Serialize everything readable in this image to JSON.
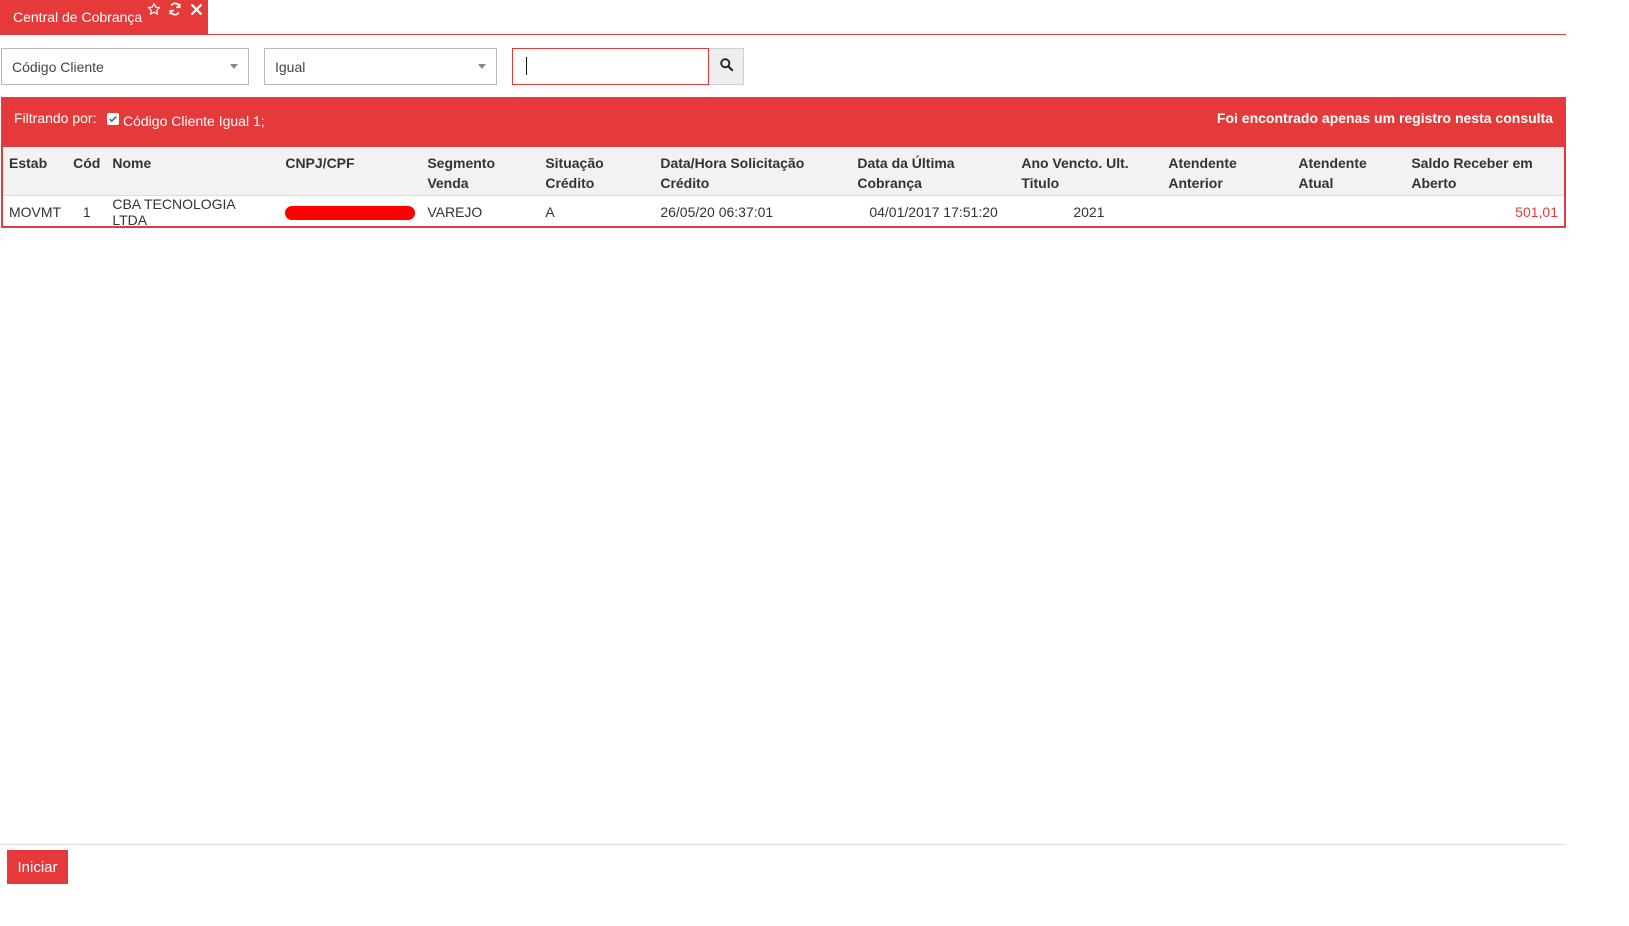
{
  "tab": {
    "title": "Central de Cobrança",
    "icons": [
      "star-icon",
      "refresh-icon",
      "close-icon"
    ]
  },
  "filter": {
    "field_selected": "Código Cliente",
    "operator_selected": "Igual",
    "search_value": "",
    "search_icon": "search-icon"
  },
  "results": {
    "filter_label": "Filtrando por:",
    "active_filter": "Código Cliente Igual 1;",
    "message": "Foi encontrado apenas um registro nesta consulta",
    "columns": [
      "Estab",
      "Cód",
      "Nome",
      "CNPJ/CPF",
      "Segmento Venda",
      "Situação Crédito",
      "Data/Hora Solicitação Crédito",
      "Data da Última Cobrança",
      "Ano Vencto. Ult. Titulo",
      "Atendente Anterior",
      "Atendente Atual",
      "Saldo Receber em Aberto"
    ],
    "rows": [
      {
        "estab": "MOVMT",
        "cod": "1",
        "nome": "CBA TECNOLOGIA LTDA",
        "segmento": "VAREJO",
        "situacao": "A",
        "data_solicitacao": "26/05/20 06:37:01",
        "data_ultima": "04/01/2017 17:51:20",
        "ano_vencto": "2021",
        "atendente_anterior": "",
        "atendente_atual": "",
        "saldo": "501,01"
      }
    ]
  },
  "footer": {
    "start_label": "Iniciar"
  },
  "colors": {
    "accent": "#e63a3a",
    "header_bg": "#f2f2f2"
  }
}
